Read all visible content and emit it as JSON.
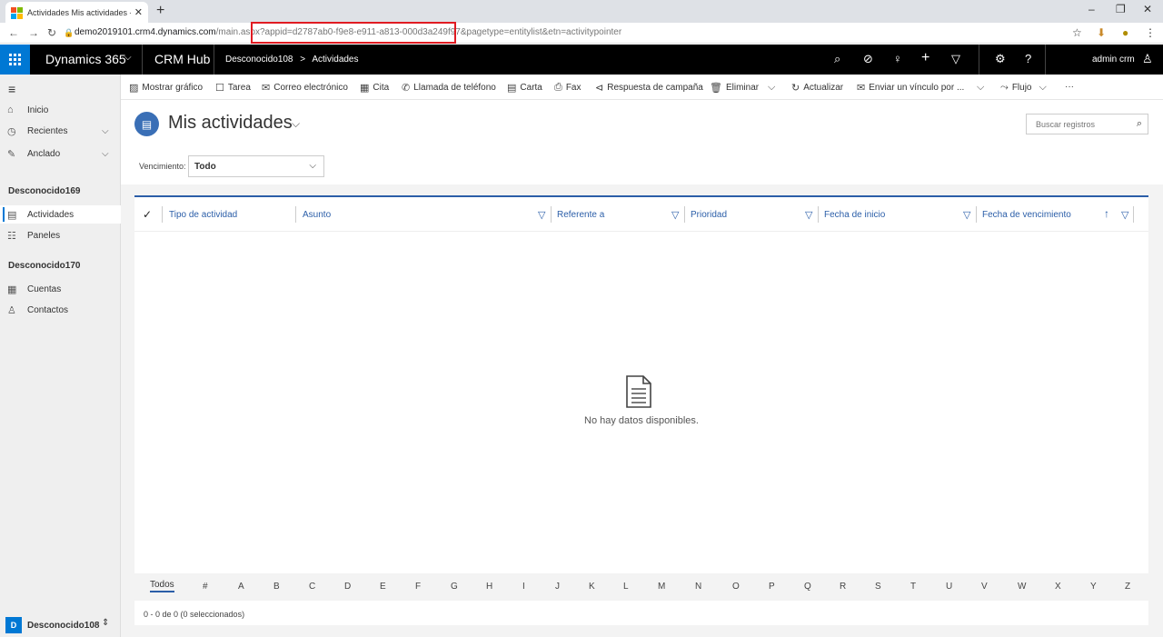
{
  "browser": {
    "tab_title": "Actividades Mis actividades - Mi",
    "tab_close": "✕",
    "new_tab": "+",
    "url_host": "demo2019101.crm4.dynamics.com",
    "url_path": "/main.aspx?appid=d2787ab0-f9e8-e911-a813-000d3a249f97&pagetype=entitylist&etn=activitypointer",
    "win_minimize": "–",
    "win_restore": "❐",
    "win_close": "✕"
  },
  "topbar": {
    "brand": "Dynamics 365",
    "app_name": "CRM Hub",
    "breadcrumb_area": "Desconocido108",
    "breadcrumb_sep": ">",
    "breadcrumb_entity": "Actividades",
    "user": "admin crm"
  },
  "commands": {
    "mostrar_grafico": "Mostrar gráfico",
    "tarea": "Tarea",
    "correo": "Correo electrónico",
    "cita": "Cita",
    "llamada": "Llamada de teléfono",
    "carta": "Carta",
    "fax": "Fax",
    "respuesta": "Respuesta de campaña",
    "eliminar": "Eliminar",
    "actualizar": "Actualizar",
    "enviar": "Enviar un vínculo por ...",
    "flujo": "Flujo",
    "more": "···"
  },
  "leftnav": {
    "inicio": "Inicio",
    "recientes": "Recientes",
    "anclado": "Anclado",
    "group1": "Desconocido169",
    "actividades": "Actividades",
    "paneles": "Paneles",
    "group2": "Desconocido170",
    "cuentas": "Cuentas",
    "contactos": "Contactos",
    "area_badge": "D",
    "area_name": "Desconocido108"
  },
  "view": {
    "title": "Mis actividades",
    "search_placeholder": "Buscar registros",
    "vencimiento_label": "Vencimiento:",
    "vencimiento_value": "Todo"
  },
  "grid": {
    "columns": [
      "Tipo de actividad",
      "Asunto",
      "Referente a",
      "Prioridad",
      "Fecha de inicio",
      "Fecha de vencimiento"
    ],
    "empty_text": "No hay datos disponibles.",
    "jump_todos": "Todos",
    "jump_letters": [
      "#",
      "A",
      "B",
      "C",
      "D",
      "E",
      "F",
      "G",
      "H",
      "I",
      "J",
      "K",
      "L",
      "M",
      "N",
      "O",
      "P",
      "Q",
      "R",
      "S",
      "T",
      "U",
      "V",
      "W",
      "X",
      "Y",
      "Z"
    ],
    "footer": "0 - 0 de 0 (0 seleccionados)"
  },
  "colors": {
    "accent": "#0078d4",
    "grid_header": "#2b5ea8",
    "highlight": "#e01b22"
  }
}
